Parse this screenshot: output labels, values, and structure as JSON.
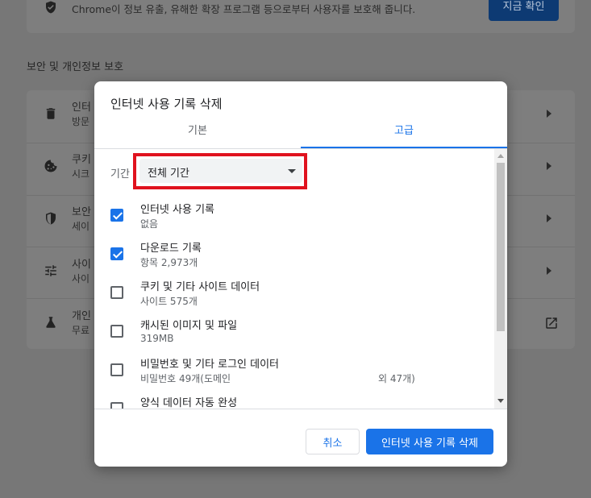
{
  "background": {
    "top_card": {
      "text": "Chrome이 정보 유출, 유해한 확장 프로그램 등으로부터 사용자를 보호해 줍니다.",
      "button_label": "지금 확인"
    },
    "section_title": "보안 및 개인정보 보호",
    "rows": [
      {
        "title": "인터",
        "subtitle": "방문",
        "icon": "trash-icon"
      },
      {
        "title": "쿠키",
        "subtitle": "시크",
        "icon": "cookie-icon"
      },
      {
        "title": "보안",
        "subtitle": "세이",
        "icon": "shield-icon"
      },
      {
        "title": "사이",
        "subtitle": "사이",
        "icon": "tune-icon"
      },
      {
        "title": "개인",
        "subtitle": "무료",
        "icon": "flask-icon"
      }
    ]
  },
  "dialog": {
    "title": "인터넷 사용 기록 삭제",
    "tabs": [
      {
        "label": "기본",
        "active": false
      },
      {
        "label": "고급",
        "active": true
      }
    ],
    "period_label": "기간",
    "period_value": "전체 기간",
    "items": [
      {
        "title": "인터넷 사용 기록",
        "subtitle": "없음",
        "subtitle2": "",
        "checked": true
      },
      {
        "title": "다운로드 기록",
        "subtitle": "항목 2,973개",
        "subtitle2": "",
        "checked": true
      },
      {
        "title": "쿠키 및 기타 사이트 데이터",
        "subtitle": "사이트 575개",
        "subtitle2": "",
        "checked": false
      },
      {
        "title": "캐시된 이미지 및 파일",
        "subtitle": "319MB",
        "subtitle2": "",
        "checked": false
      },
      {
        "title": "비밀번호 및 기타 로그인 데이터",
        "subtitle": "비밀번호 49개(도메인",
        "subtitle2": "외 47개)",
        "checked": false
      },
      {
        "title": "양식 데이터 자동 완성",
        "subtitle": "",
        "subtitle2": "",
        "checked": false
      }
    ],
    "cancel_label": "취소",
    "confirm_label": "인터넷 사용 기록 삭제"
  },
  "colors": {
    "accent": "#1a73e8",
    "highlight": "#e0121e",
    "overlay": "#777777"
  }
}
